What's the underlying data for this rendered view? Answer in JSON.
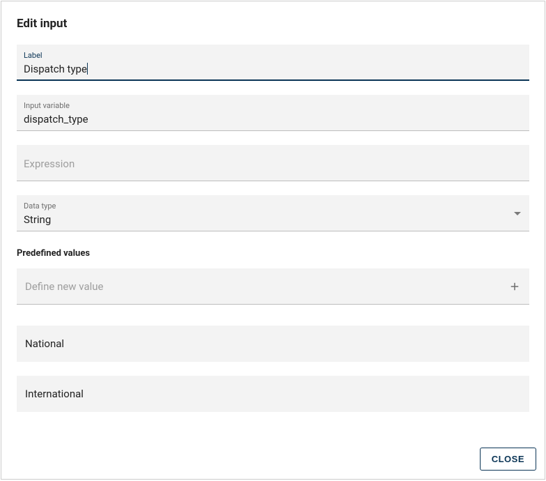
{
  "dialog": {
    "title": "Edit input"
  },
  "fields": {
    "label": {
      "label": "Label",
      "value": "Dispatch type"
    },
    "input_variable": {
      "label": "Input variable",
      "value": "dispatch_type"
    },
    "expression": {
      "placeholder": "Expression",
      "value": ""
    },
    "data_type": {
      "label": "Data type",
      "value": "String"
    }
  },
  "predefined": {
    "heading": "Predefined values",
    "new_value_placeholder": "Define new value",
    "values": [
      "National",
      "International"
    ]
  },
  "footer": {
    "close": "CLOSE"
  }
}
